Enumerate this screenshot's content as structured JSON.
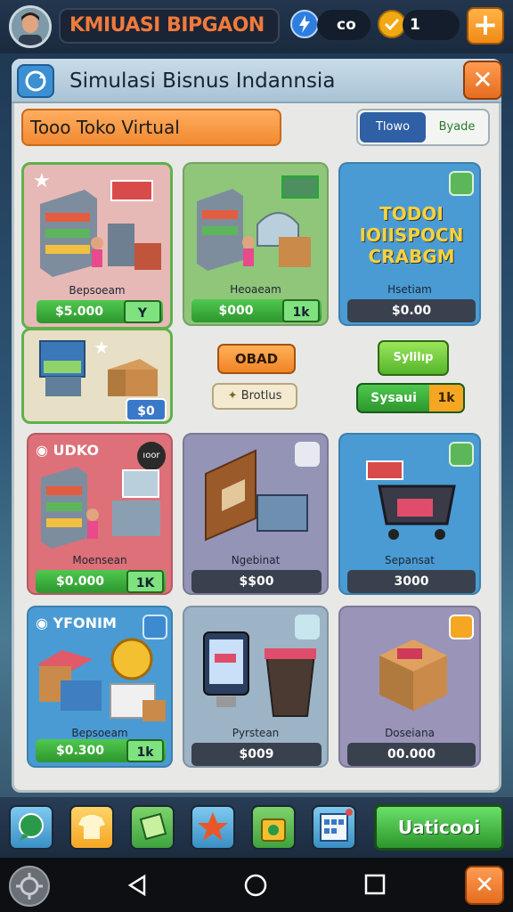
{
  "header": {
    "title": "KMIUASI BIPGAON",
    "stat1_value": "co",
    "coins_value": "1",
    "plus_label": "+"
  },
  "panel": {
    "title": "Simulasi Bisnus Indannsia",
    "close_label": "✕",
    "subtitle": "Tooo Toko Virtual",
    "toggle": [
      "Tlowo",
      "Byade"
    ]
  },
  "cards": [
    {
      "label": "Bepsoeam",
      "price": "$5.000",
      "tag": "Y"
    },
    {
      "label": "Heoaeam",
      "price": "$000",
      "tag": "1k"
    },
    {
      "label": "Hsetiam",
      "price": "$0.00",
      "headline": [
        "TODOI",
        "IOIISPOCN",
        "CRABGM"
      ]
    },
    {
      "label": "",
      "price": "",
      "tag": "$0"
    },
    {
      "label": "Moensean",
      "price": "$0.000",
      "tag": "1K",
      "badge": "UDKO",
      "corner": "ıoor"
    },
    {
      "label": "Ngebinat",
      "price": "$$00"
    },
    {
      "label": "Sepansat",
      "price": "3000"
    },
    {
      "label": "Bepsoeam",
      "price": "$0.300",
      "tag": "1k",
      "badge": "YFONIM"
    },
    {
      "label": "Pyrstean",
      "price": "$009"
    },
    {
      "label": "Doseiana",
      "price": "00.000"
    }
  ],
  "middle": {
    "orange_btn": "OBAD",
    "beige_btn": "Brotlus",
    "green_btn": "Sylilıp",
    "sysaui_label": "Sysaui",
    "sysaui_tag": "1k"
  },
  "dock": {
    "action_label": "Uaticooi"
  },
  "colors": {
    "accent_orange": "#f28a32",
    "accent_green": "#2d962d",
    "panel_bg": "#e8e9e7",
    "dark_price": "#38414d"
  }
}
